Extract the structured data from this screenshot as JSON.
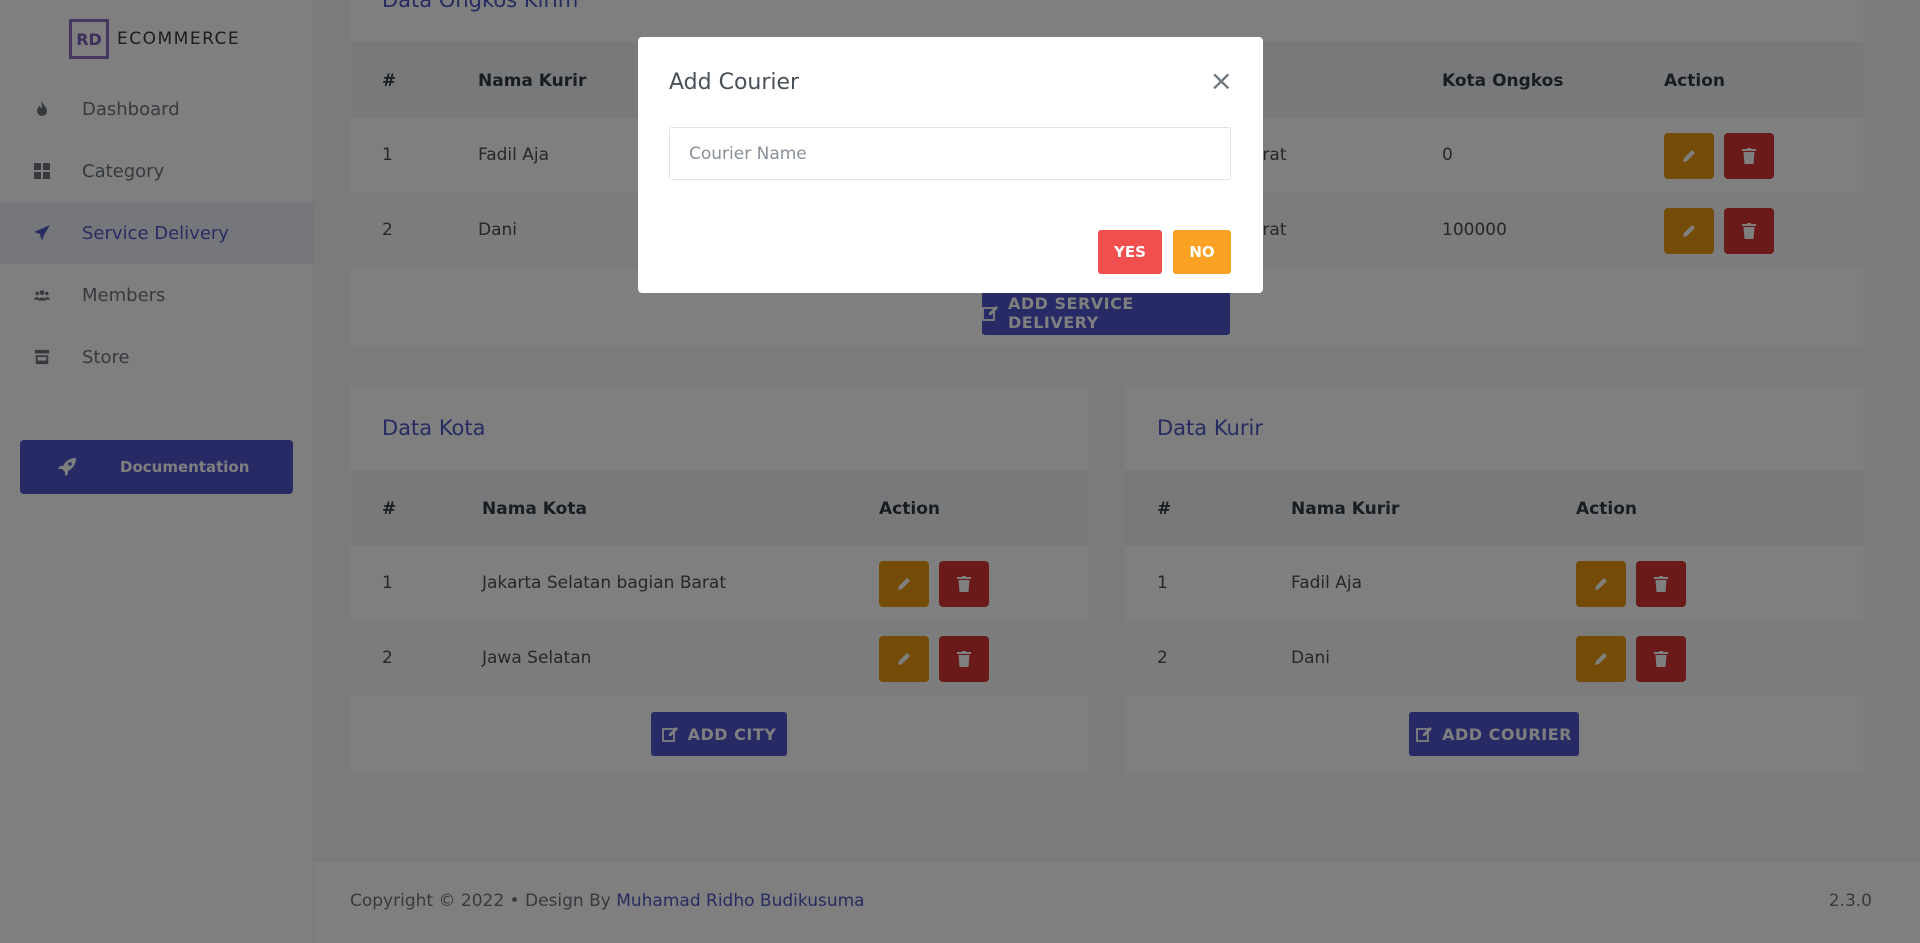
{
  "brand": {
    "logo": "RD",
    "name": "ECOMMERCE"
  },
  "sidebar": {
    "items": [
      {
        "label": "Dashboard",
        "icon": "fire-icon"
      },
      {
        "label": "Category",
        "icon": "grid-icon"
      },
      {
        "label": "Service Delivery",
        "icon": "paper-plane-icon",
        "active": true
      },
      {
        "label": "Members",
        "icon": "users-icon"
      },
      {
        "label": "Store",
        "icon": "store-icon"
      }
    ],
    "doc_button": "Documentation"
  },
  "ongkos": {
    "title": "Data Ongkos Kirim",
    "headers": {
      "num": "#",
      "kurir": "Nama Kurir",
      "kota_ongkos": "Kota Ongkos",
      "action": "Action"
    },
    "rows": [
      {
        "num": "1",
        "kurir": "Fadil Aja",
        "kota": "arat",
        "ongkos": "0"
      },
      {
        "num": "2",
        "kurir": "Dani",
        "kota": "arat",
        "ongkos": "100000"
      }
    ],
    "add_button": "ADD SERVICE DELIVERY"
  },
  "kota": {
    "title": "Data Kota",
    "headers": {
      "num": "#",
      "nama": "Nama Kota",
      "action": "Action"
    },
    "rows": [
      {
        "num": "1",
        "nama": "Jakarta Selatan bagian Barat"
      },
      {
        "num": "2",
        "nama": "Jawa Selatan"
      }
    ],
    "add_button": "ADD CITY"
  },
  "kurir": {
    "title": "Data Kurir",
    "headers": {
      "num": "#",
      "nama": "Nama Kurir",
      "action": "Action"
    },
    "rows": [
      {
        "num": "1",
        "nama": "Fadil Aja"
      },
      {
        "num": "2",
        "nama": "Dani"
      }
    ],
    "add_button": "ADD COURIER"
  },
  "footer": {
    "copyright": "Copyright © 2022  •  Design By ",
    "author": "Muhamad Ridho Budikusuma",
    "version": "2.3.0"
  },
  "modal": {
    "title": "Add Courier",
    "close": "×",
    "input_placeholder": "Courier Name",
    "input_value": "",
    "yes": "YES",
    "no": "NO"
  },
  "colors": {
    "primary": "#4e55c8",
    "edit": "#e8990f",
    "delete": "#d63434",
    "yes": "#f14e4e",
    "no": "#fba124"
  }
}
